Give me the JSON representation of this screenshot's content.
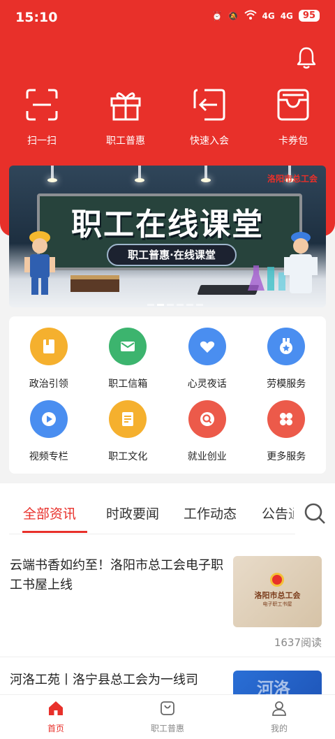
{
  "colors": {
    "brand": "#e8302a",
    "background": "#f3f3f3"
  },
  "status_bar": {
    "time": "15:10",
    "signal_1": "4G",
    "signal_2": "4G",
    "battery": "95"
  },
  "header": {
    "bell_icon": "bell-icon"
  },
  "quick_actions": [
    {
      "label": "扫一扫",
      "icon": "scan-icon"
    },
    {
      "label": "职工普惠",
      "icon": "gift-icon"
    },
    {
      "label": "快速入会",
      "icon": "join-icon"
    },
    {
      "label": "卡券包",
      "icon": "wallet-icon"
    }
  ],
  "banner": {
    "title": "职工在线课堂",
    "subtitle": "职工普惠·在线课堂",
    "logo_text": "洛阳市总工会",
    "active_slide": 2,
    "slide_count": 6
  },
  "services": [
    {
      "label": "政治引领",
      "icon": "book-icon",
      "color": "#f5b02e"
    },
    {
      "label": "职工信箱",
      "icon": "mail-icon",
      "color": "#3cb46e"
    },
    {
      "label": "心灵夜话",
      "icon": "hearts-icon",
      "color": "#4a8ef0"
    },
    {
      "label": "劳模服务",
      "icon": "medal-icon",
      "color": "#4a8ef0"
    },
    {
      "label": "视频专栏",
      "icon": "play-icon",
      "color": "#4a8ef0"
    },
    {
      "label": "职工文化",
      "icon": "document-icon",
      "color": "#f5b02e"
    },
    {
      "label": "就业创业",
      "icon": "search-job-icon",
      "color": "#ec5a4a"
    },
    {
      "label": "更多服务",
      "icon": "more-icon",
      "color": "#ec5a4a"
    }
  ],
  "news_tabs": [
    {
      "label": "全部资讯",
      "active": true
    },
    {
      "label": "时政要闻",
      "active": false
    },
    {
      "label": "工作动态",
      "active": false
    },
    {
      "label": "公告通",
      "active": false
    }
  ],
  "news": [
    {
      "title": "云端书香如约至！洛阳市总工会电子职工书屋上线",
      "thumb_title": "洛阳市总工会",
      "thumb_subtitle": "电子职工书屋",
      "reads": "1637阅读"
    },
    {
      "title": "河洛工苑丨洛宁县总工会为一线司",
      "thumb_title": "河洛"
    }
  ],
  "bottom_nav": [
    {
      "label": "首页",
      "icon": "home-icon",
      "active": true
    },
    {
      "label": "职工普惠",
      "icon": "bag-icon",
      "active": false
    },
    {
      "label": "我的",
      "icon": "user-icon",
      "active": false
    }
  ]
}
